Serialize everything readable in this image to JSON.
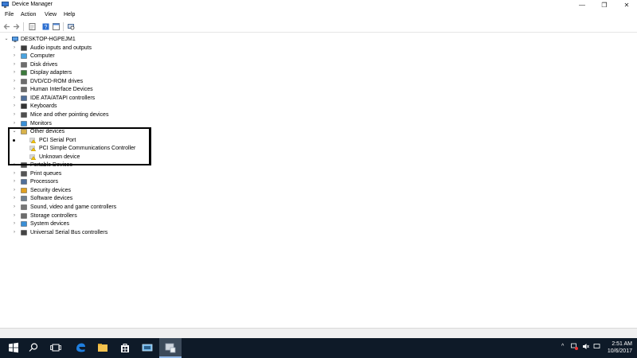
{
  "window": {
    "title": "Device Manager",
    "minimize": "—",
    "maximize": "❐",
    "close": "✕"
  },
  "menu": {
    "file": "File",
    "action": "Action",
    "view": "View",
    "help": "Help"
  },
  "tree": {
    "root": "DESKTOP-HGPEJM1",
    "categories": [
      "Audio inputs and outputs",
      "Computer",
      "Disk drives",
      "Display adapters",
      "DVD/CD-ROM drives",
      "Human Interface Devices",
      "IDE ATA/ATAPI controllers",
      "Keyboards",
      "Mice and other pointing devices",
      "Monitors",
      "Other devices",
      "Portable Devices",
      "Print queues",
      "Processors",
      "Security devices",
      "Software devices",
      "Sound, video and game controllers",
      "Storage controllers",
      "System devices",
      "Universal Serial Bus controllers"
    ],
    "other_devices_children": [
      "PCI Serial Port",
      "PCI Simple Communications Controller",
      "Unknown device"
    ]
  },
  "taskbar": {
    "time": "2:51 AM",
    "date": "10/6/2017"
  }
}
